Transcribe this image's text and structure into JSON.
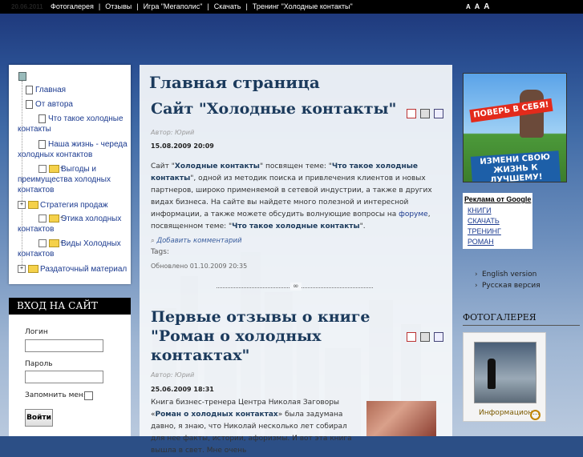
{
  "topbar": {
    "date": "20.06.2011",
    "nav": [
      "Фотогалерея",
      "Отзывы",
      "Игра \"Мегаполис\"",
      "Скачать",
      "Тренинг \"Холодные контакты\""
    ],
    "font_sizes": [
      "A",
      "A",
      "A"
    ]
  },
  "menu": {
    "items": [
      {
        "label": "Главная"
      },
      {
        "label": "От автора"
      },
      {
        "label": "Что такое холодные контакты"
      },
      {
        "label": "Наша жизнь - череда холодных контактов"
      },
      {
        "label": "Выгоды и преимущества холодных контактов"
      },
      {
        "label": "Стратегия продаж"
      },
      {
        "label": "Этика холодных контактов"
      },
      {
        "label": "Виды Холодных контактов"
      },
      {
        "label": "Раздаточный материал"
      }
    ]
  },
  "login": {
    "title": "ВХОД НА САЙТ",
    "login_label": "Логин",
    "password_label": "Пароль",
    "remember_label": "Запомнить меня",
    "submit": "Войти"
  },
  "main": {
    "page_title": "Главная страница",
    "articles": [
      {
        "title": "Сайт \"Холодные контакты\"",
        "author": "Автор: Юрий",
        "date": "15.08.2009 20:09",
        "text1": "Сайт \"",
        "bold1": "Холодные контакты",
        "text2": "\" посвящен теме: \"",
        "bold2": "Что такое холодные контакты",
        "text3": "\", одной из методик поиска и привлечения клиентов и новых партнеров, широко применяемой в сетевой индустрии, а также в других видах бизнеса. На сайте вы найдете много полезной и интересной информации, а также можете обсудить волнующие вопросы на ",
        "link1": "форуме",
        "text4": ", посвященном теме: \"",
        "bold3": "Что такое холодные контакты",
        "text5": "\".",
        "comment": "Добавить комментарий",
        "tags": "Tags:",
        "updated": "Обновлено 01.10.2009 20:35"
      },
      {
        "title": "Первые отзывы о книге \"Роман о холодных контактах\"",
        "author": "Автор: Юрий",
        "date": "25.06.2009 18:31",
        "text1": "Книга бизнес-тренера Центра Николая Заговоры «",
        "bold1": "Роман о холодных контактах",
        "text2": "» была задумана давно, я знаю, что Николай несколько лет собирал для нее факты, истории, афоризмы. И вот эта книга вышла в свет. Мне очень"
      }
    ]
  },
  "right": {
    "banner_top": "ПОВЕРЬ В СЕБЯ!",
    "banner_bottom": "ИЗМЕНИ СВОЮ ЖИЗНЬ К ЛУЧШЕМУ!",
    "ads_title": "Реклама от Google",
    "ads": [
      "КНИГИ",
      "СКАЧАТЬ",
      "ТРЕНИНГ",
      "РОМАН"
    ],
    "languages": [
      "English version",
      "Русская версия"
    ],
    "gallery_title": "ФОТОГАЛЕРЕЯ",
    "gallery_caption": "Информацион..."
  }
}
